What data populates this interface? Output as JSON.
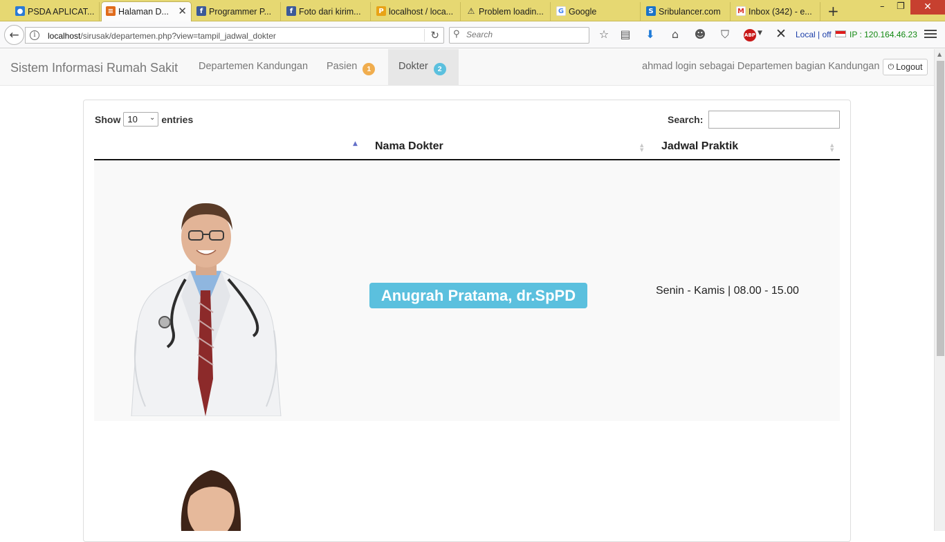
{
  "browser": {
    "tabs": [
      {
        "label": "PSDA APLICAT...",
        "favicon": "drop-icon",
        "color": "#2a7ad5",
        "glyph": "💧"
      },
      {
        "label": "Halaman D...",
        "favicon": "page-icon",
        "color": "#e06b1b",
        "glyph": "≡",
        "active": true
      },
      {
        "label": "Programmer P...",
        "favicon": "facebook-icon",
        "color": "#3b5998",
        "glyph": "f"
      },
      {
        "label": "Foto dari kirim...",
        "favicon": "facebook-icon",
        "color": "#3b5998",
        "glyph": "f"
      },
      {
        "label": "localhost / loca...",
        "favicon": "phpmyadmin-icon",
        "color": "#e8a317",
        "glyph": "P"
      },
      {
        "label": "Problem loadin...",
        "favicon": "warning-icon",
        "color": "#e6d872",
        "glyph": "⚠"
      },
      {
        "label": "Google",
        "favicon": "google-icon",
        "color": "#4285f4",
        "glyph": "G"
      },
      {
        "label": "Sribulancer.com",
        "favicon": "sribulancer-icon",
        "color": "#1a73c8",
        "glyph": "S"
      },
      {
        "label": "Inbox (342) - e...",
        "favicon": "gmail-icon",
        "color": "#d93025",
        "glyph": "M"
      }
    ],
    "url_host": "localhost",
    "url_path": "/sirusak/departemen.php?view=tampil_jadwal_dokter",
    "search_placeholder": "Search",
    "addon_local": "Local | off",
    "addon_ip": "IP : 120.164.46.23",
    "adblock_label": "ABP"
  },
  "app": {
    "brand": "Sistem Informasi Rumah Sakit",
    "nav": {
      "departemen": "Departemen Kandungan",
      "pasien": "Pasien",
      "pasien_badge": "1",
      "dokter": "Dokter",
      "dokter_badge": "2"
    },
    "login_text": "ahmad login sebagai Departemen bagian Kandungan |",
    "logout_label": "Logout"
  },
  "table": {
    "show_label": "Show",
    "entries_value": "10",
    "entries_label": "entries",
    "search_label": "Search:",
    "columns": [
      "Nama Dokter",
      "Jadwal Praktik"
    ],
    "rows": [
      {
        "name": "Anugrah Pratama, dr.SpPD",
        "schedule": "Senin - Kamis | 08.00 - 15.00"
      }
    ]
  }
}
